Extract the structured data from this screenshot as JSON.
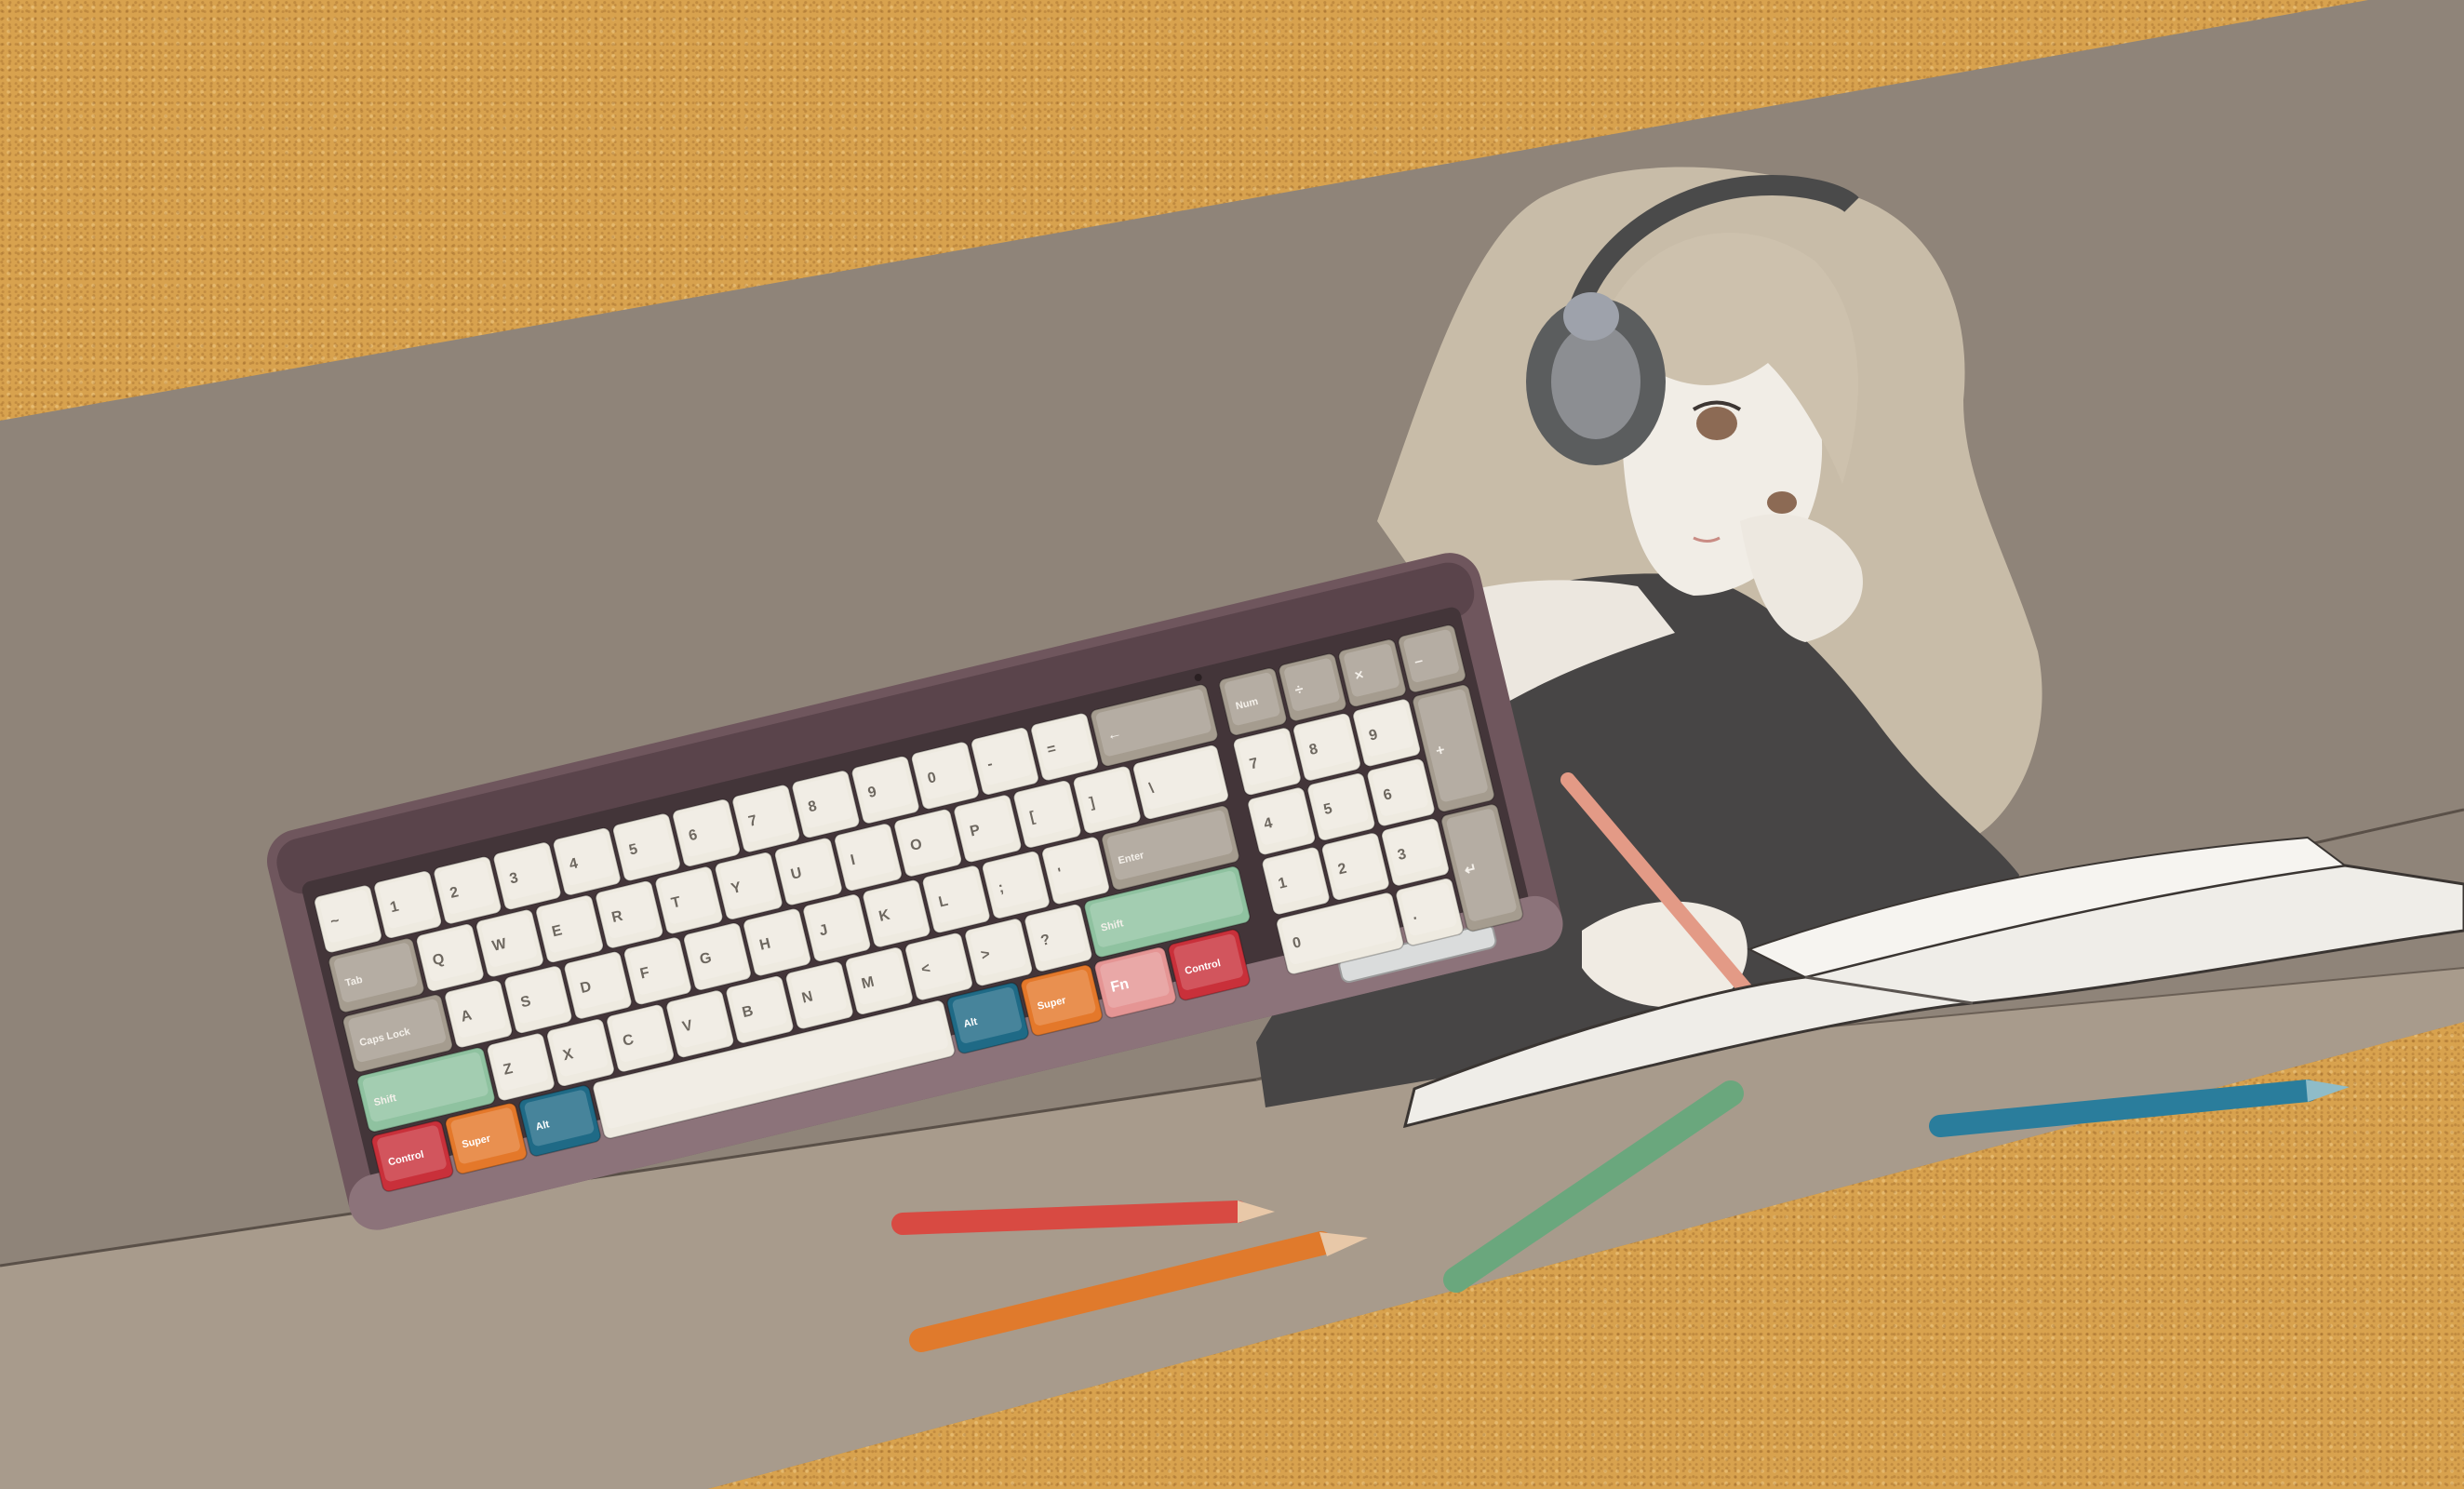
{
  "scene": {
    "colors": {
      "cork": "#d8a24e",
      "deskmat": "#8f8479",
      "deskmat_lower": "#b0a394",
      "case": "#7a6268",
      "key_cream": "#eeeae0",
      "key_taupe": "#a59c8f",
      "key_green": "#8fc2a0",
      "key_red": "#c9303a",
      "key_orange": "#e4782a",
      "key_blue": "#1f6a86",
      "key_pink": "#e59594",
      "pencil_red": "#d84a42",
      "pencil_orange": "#e07a2c",
      "pencil_green": "#6aa77d",
      "pencil_blue": "#2a7d9c"
    }
  },
  "keyboard": {
    "legends": {
      "enter": "Enter",
      "shift_right": "Shift",
      "shift_left": "Shift",
      "control_right": "Control",
      "control_left": "Control",
      "fn": "Fn",
      "super_right": "Super",
      "super_left": "Super",
      "alt_right": "Alt",
      "alt_left": "Alt",
      "caps_lock": "Caps Lock",
      "tab": "Tab",
      "num": "Num",
      "div": "÷",
      "mul": "×",
      "minus": "–",
      "plus": "+"
    },
    "row_number": [
      "~",
      "1",
      "2",
      "3",
      "4",
      "5",
      "6",
      "7",
      "8",
      "9",
      "0",
      "-",
      "="
    ],
    "row_top": [
      "Q",
      "W",
      "E",
      "R",
      "T",
      "Y",
      "U",
      "I",
      "O",
      "P",
      "[",
      "]",
      "\\"
    ],
    "row_home": [
      "A",
      "S",
      "D",
      "F",
      "G",
      "H",
      "J",
      "K",
      "L",
      ";",
      "'"
    ],
    "row_bottom": [
      "Z",
      "X",
      "C",
      "V",
      "B",
      "N",
      "M",
      "<",
      ">",
      "?"
    ],
    "numpad": [
      "7",
      "8",
      "9",
      "4",
      "5",
      "6",
      "1",
      "2",
      "3",
      "0",
      "."
    ]
  }
}
